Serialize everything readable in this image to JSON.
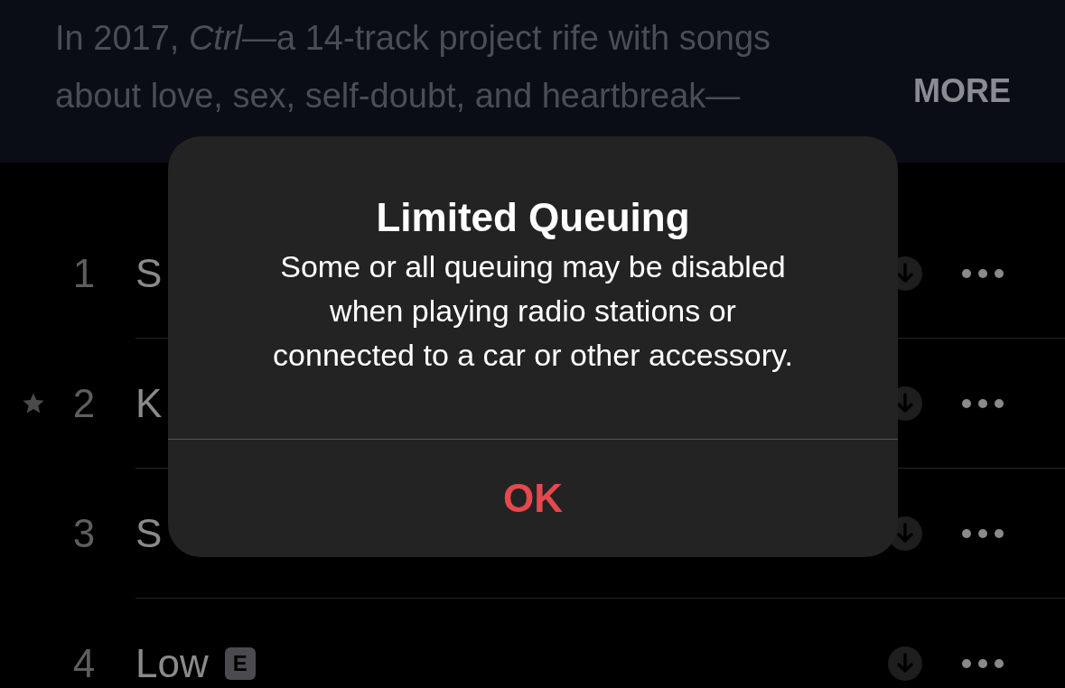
{
  "description": {
    "lines": [
      "In 2017, *Ctrl*—a 14-track project rife with songs",
      "about love, sex, self-doubt, and heartbreak—"
    ],
    "more": "MORE"
  },
  "tracks": [
    {
      "number": "1",
      "title": "S",
      "favorite": false
    },
    {
      "number": "2",
      "title": "K",
      "favorite": true
    },
    {
      "number": "3",
      "title": "S",
      "favorite": false
    },
    {
      "number": "4",
      "title": "Low",
      "favorite": false,
      "badge": "E"
    }
  ],
  "alert": {
    "title": "Limited Queuing",
    "message_lines": [
      "Some or all queuing may be disabled",
      "when playing radio stations or",
      "connected to a car or other accessory."
    ],
    "button": "OK"
  }
}
